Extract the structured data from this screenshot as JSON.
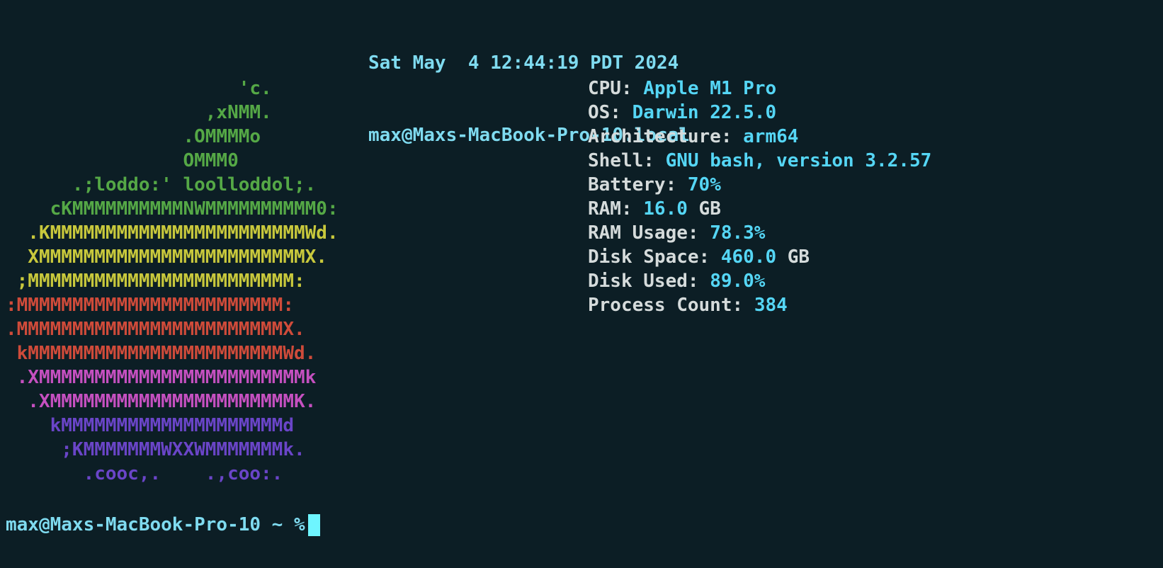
{
  "terminal": {
    "background_color": "#0c1e25",
    "header_color": "#7fdbf0",
    "label_color": "#d5dbdb",
    "value_color": "#55d6f5",
    "cursor_color": "#6ef5ff"
  },
  "header": {
    "datetime": "Sat May  4 12:44:19 PDT 2024",
    "userhost": "max@Maxs-MacBook-Pro-10.local"
  },
  "ascii_art": {
    "description": "apple-logo-ascii",
    "lines": [
      {
        "text": "                     'c.",
        "color": "#55a846"
      },
      {
        "text": "                  ,xNMM.",
        "color": "#55a846"
      },
      {
        "text": "                .OMMMMo",
        "color": "#55a846"
      },
      {
        "text": "                OMMM0",
        "color": "#55a846"
      },
      {
        "text": "      .;loddo:' loolloddol;.",
        "color": "#55a846"
      },
      {
        "text": "    cKMMMMMMMMMMNWMMMMMMMMMM0:",
        "color": "#55a846"
      },
      {
        "text": "  .KMMMMMMMMMMMMMMMMMMMMMMMWd.",
        "color": "#c8c83c"
      },
      {
        "text": "  XMMMMMMMMMMMMMMMMMMMMMMMMX.",
        "color": "#c8c83c"
      },
      {
        "text": " ;MMMMMMMMMMMMMMMMMMMMMMMM:",
        "color": "#c8c83c"
      },
      {
        "text": ":MMMMMMMMMMMMMMMMMMMMMMMM:",
        "color": "#cf4b3a"
      },
      {
        "text": ".MMMMMMMMMMMMMMMMMMMMMMMMX.",
        "color": "#cf4b3a"
      },
      {
        "text": " kMMMMMMMMMMMMMMMMMMMMMMMWd.",
        "color": "#cf4b3a"
      },
      {
        "text": " .XMMMMMMMMMMMMMMMMMMMMMMMMk",
        "color": "#c550c0"
      },
      {
        "text": "  .XMMMMMMMMMMMMMMMMMMMMMMK.",
        "color": "#c550c0"
      },
      {
        "text": "    kMMMMMMMMMMMMMMMMMMMMd",
        "color": "#6a45c8"
      },
      {
        "text": "     ;KMMMMMMMWXXWMMMMMMMk.",
        "color": "#6a45c8"
      },
      {
        "text": "       .cooc,.    .,coo:.",
        "color": "#6a45c8"
      }
    ]
  },
  "info": {
    "rows": [
      {
        "label": "CPU: ",
        "value": "Apple M1 Pro",
        "unit": ""
      },
      {
        "label": "OS: ",
        "value": "Darwin 22.5.0",
        "unit": ""
      },
      {
        "label": "Architecture: ",
        "value": "arm64",
        "unit": ""
      },
      {
        "label": "Shell: ",
        "value": "GNU bash, version 3.2.57",
        "unit": ""
      },
      {
        "label": "Battery: ",
        "value": "70%",
        "unit": ""
      },
      {
        "label": "RAM: ",
        "value": "16.0",
        "unit": " GB"
      },
      {
        "label": "RAM Usage: ",
        "value": "78.3%",
        "unit": ""
      },
      {
        "label": "Disk Space: ",
        "value": "460.0",
        "unit": " GB"
      },
      {
        "label": "Disk Used: ",
        "value": "89.0%",
        "unit": ""
      },
      {
        "label": "Process Count: ",
        "value": "384",
        "unit": ""
      }
    ]
  },
  "prompt": {
    "text": "max@Maxs-MacBook-Pro-10 ~ %",
    "input_value": ""
  }
}
